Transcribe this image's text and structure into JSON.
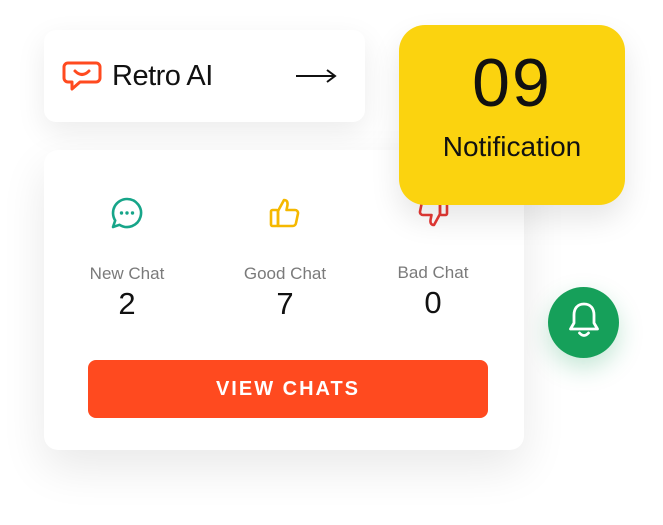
{
  "brand": {
    "name": "Retro AI",
    "logo_icon": "speech-bubble-smile-icon",
    "arrow_icon": "arrow-right-icon"
  },
  "notification": {
    "count": "09",
    "label": "Notification"
  },
  "stats": [
    {
      "label": "New Chat",
      "value": "2",
      "icon": "chat-bubble-dots-icon",
      "color": "#17a589"
    },
    {
      "label": "Good Chat",
      "value": "7",
      "icon": "thumbs-up-icon",
      "color": "#f5b800"
    },
    {
      "label": "Bad Chat",
      "value": "0",
      "icon": "thumbs-down-icon",
      "color": "#e53935"
    }
  ],
  "actions": {
    "view_chats": "VIEW CHATS"
  },
  "bell": {
    "icon": "bell-icon",
    "color": "#16a05a"
  },
  "colors": {
    "accent_orange": "#ff4a1f",
    "notification_yellow": "#fbd30f",
    "green": "#16a05a"
  }
}
